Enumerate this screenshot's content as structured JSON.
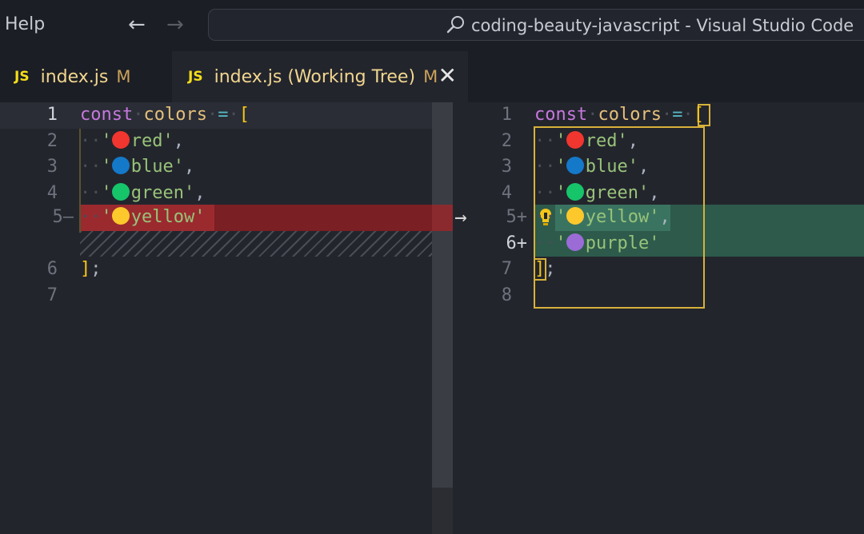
{
  "titlebar": {
    "menu_help": "Help",
    "back_icon": "arrow-left-icon",
    "forward_icon": "arrow-right-icon",
    "command_center_text": "coding-beauty-javascript - Visual Studio Code"
  },
  "tabs": [
    {
      "icon": "JS",
      "label": "index.js",
      "status": "M",
      "active": false
    },
    {
      "icon": "JS",
      "label": "index.js (Working Tree)",
      "status": "M",
      "active": true
    }
  ],
  "diff": {
    "change_arrow": "→",
    "left": {
      "line_numbers": [
        "1",
        "2",
        "3",
        "4",
        "5—",
        "6",
        "7"
      ],
      "lines": {
        "const": "const",
        "colors": "colors",
        "eq": "=",
        "open": "[",
        "red": "red'",
        "blue": "blue'",
        "green": "green'",
        "yellow": "yellow'",
        "close": "]",
        "semi": ";"
      }
    },
    "right": {
      "line_numbers": [
        "1",
        "2",
        "3",
        "4",
        "5+",
        "6+",
        "7",
        "8"
      ],
      "lines": {
        "const": "const",
        "colors": "colors",
        "eq": "=",
        "open": "[",
        "red": "red'",
        "blue": "blue'",
        "green": "green'",
        "yellow": "yellow'",
        "purple": "purple'",
        "close": "]",
        "semi": ";"
      }
    }
  },
  "colors": {
    "red": "#f0362f",
    "blue": "#1479c9",
    "green": "#16c46a",
    "yellow": "#fcc82c",
    "purple": "#9b6bd6",
    "deleted_bg": "#7a1f24",
    "inserted_bg": "#2d5a4b"
  }
}
